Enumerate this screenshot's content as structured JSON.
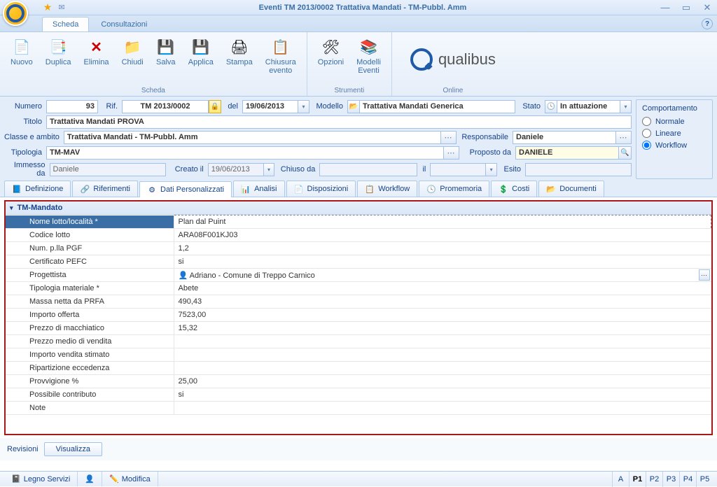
{
  "titlebar": {
    "title": "Eventi TM 2013/0002 Trattativa Mandati - TM-Pubbl. Amm"
  },
  "maintabs": {
    "scheda": "Scheda",
    "consultazioni": "Consultazioni"
  },
  "ribbon": {
    "group_scheda": "Scheda",
    "group_strumenti": "Strumenti",
    "group_online": "Online",
    "nuovo": "Nuovo",
    "duplica": "Duplica",
    "elimina": "Elimina",
    "chiudi": "Chiudi",
    "salva": "Salva",
    "applica": "Applica",
    "stampa": "Stampa",
    "chiusura": "Chiusura\nevento",
    "opzioni": "Opzioni",
    "modelli": "Modelli\nEventi",
    "brand": "qualibus"
  },
  "form": {
    "numero_lbl": "Numero",
    "numero": "93",
    "rif_lbl": "Rif.",
    "rif": "TM 2013/0002",
    "del_lbl": "del",
    "del": "19/06/2013",
    "modello_lbl": "Modello",
    "modello": "Trattativa Mandati Generica",
    "stato_lbl": "Stato",
    "stato": "In attuazione",
    "titolo_lbl": "Titolo",
    "titolo": "Trattativa Mandati PROVA",
    "classe_lbl": "Classe e ambito",
    "classe": "Trattativa Mandati - TM-Pubbl. Amm",
    "tipologia_lbl": "Tipologia",
    "tipologia": "TM-MAV",
    "responsabile_lbl": "Responsabile",
    "responsabile": "Daniele",
    "proposto_lbl": "Proposto da",
    "proposto": "DANIELE",
    "immesso_lbl": "Immesso da",
    "immesso": "Daniele",
    "creato_lbl": "Creato il",
    "creato": "19/06/2013",
    "chiuso_lbl": "Chiuso da",
    "chiuso": "",
    "il_lbl": "il",
    "il": "",
    "esito_lbl": "Esito",
    "esito": ""
  },
  "behavior": {
    "title": "Comportamento",
    "normale": "Normale",
    "lineare": "Lineare",
    "workflow": "Workflow"
  },
  "innertabs": {
    "definizione": "Definizione",
    "riferimenti": "Riferimenti",
    "dati": "Dati Personalizzati",
    "analisi": "Analisi",
    "disposizioni": "Disposizioni",
    "workflow": "Workflow",
    "promemoria": "Promemoria",
    "costi": "Costi",
    "documenti": "Documenti"
  },
  "group_name": "TM-Mandato",
  "props": [
    {
      "n": "Nome lotto/località *",
      "v": "Plan dal Puint",
      "sel": true
    },
    {
      "n": "Codice lotto",
      "v": "ARA08F001KJ03"
    },
    {
      "n": "Num. p.lla PGF",
      "v": "1,2"
    },
    {
      "n": "Certificato PEFC",
      "v": "si"
    },
    {
      "n": "Progettista",
      "v": "Adriano - Comune di Treppo Carnico",
      "pick": true,
      "icon": true
    },
    {
      "n": "Tipologia materiale *",
      "v": "Abete"
    },
    {
      "n": "Massa netta da PRFA",
      "v": "490,43"
    },
    {
      "n": "Importo offerta",
      "v": "7523,00"
    },
    {
      "n": "Prezzo di macchiatico",
      "v": "15,32"
    },
    {
      "n": "Prezzo medio di vendita",
      "v": ""
    },
    {
      "n": "Importo vendita stimato",
      "v": ""
    },
    {
      "n": "Ripartizione eccedenza",
      "v": ""
    },
    {
      "n": "Provvigione %",
      "v": "25,00"
    },
    {
      "n": "Possibile contributo",
      "v": "si"
    },
    {
      "n": "Note",
      "v": ""
    }
  ],
  "revisioni": {
    "label": "Revisioni",
    "visualizza": "Visualizza"
  },
  "status": {
    "left": "Legno Servizi",
    "modifica": "Modifica",
    "pages": [
      "A",
      "P1",
      "P2",
      "P3",
      "P4",
      "P5"
    ],
    "active": "P1"
  }
}
